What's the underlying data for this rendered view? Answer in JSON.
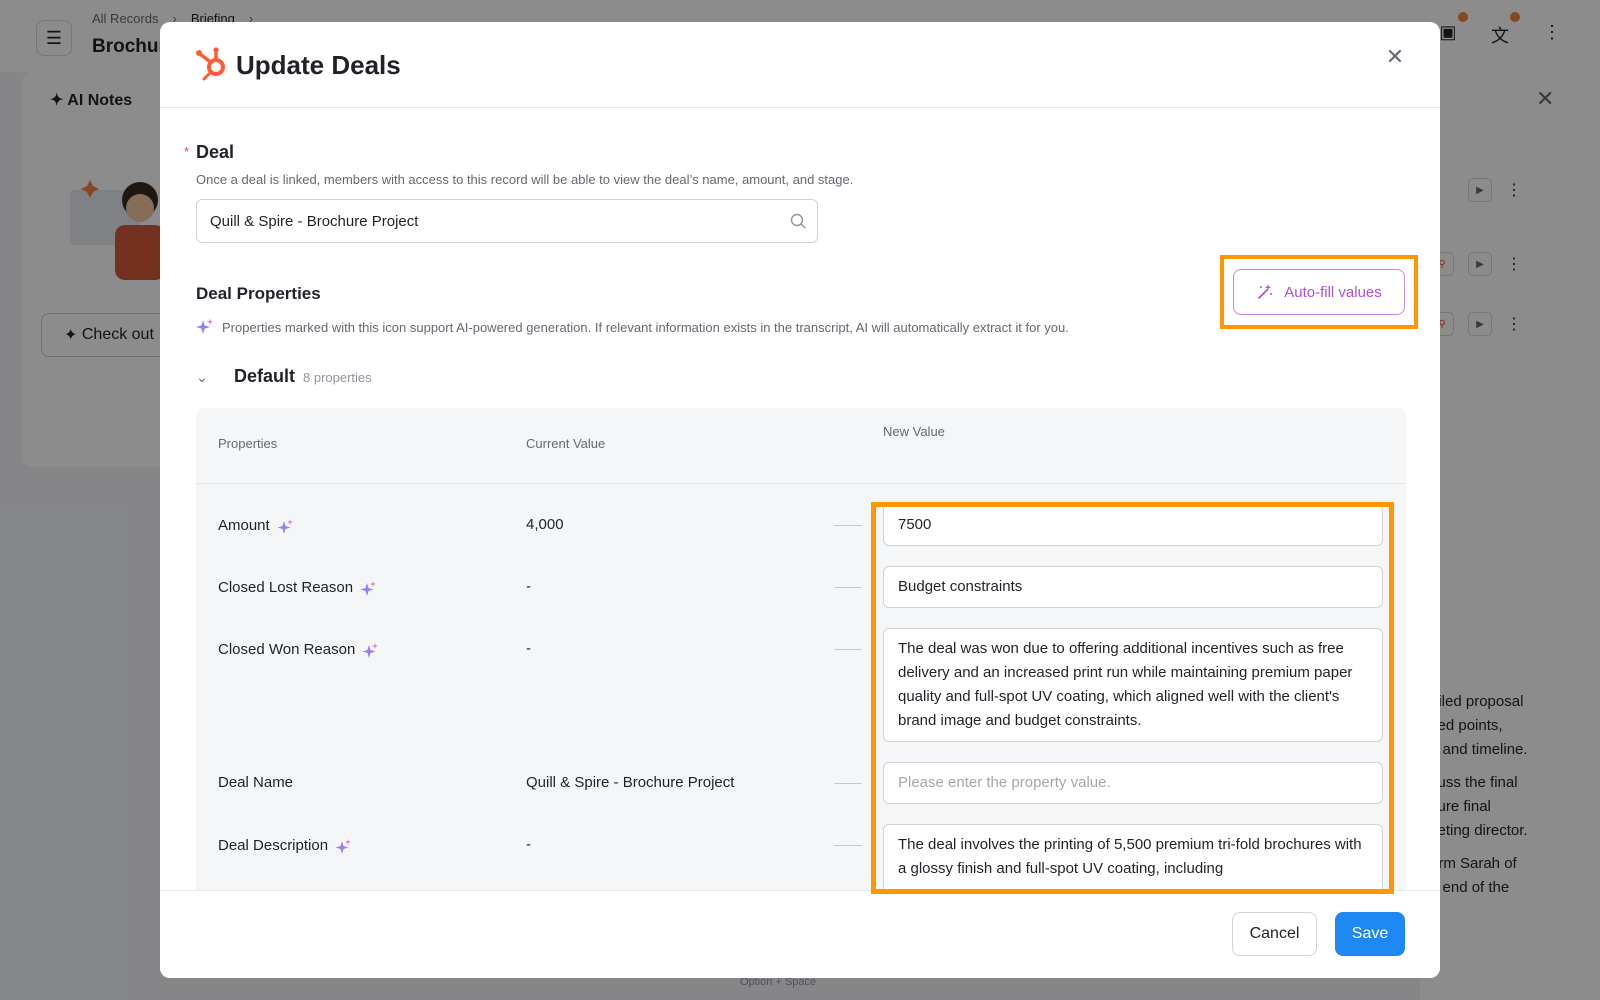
{
  "background": {
    "breadcrumb": [
      "All Records",
      "Briefing"
    ],
    "title": "Brochure",
    "ai_notes_title": "AI Notes",
    "check_out_button": "Check out",
    "right_text": [
      "ailed proposal",
      "sed points,",
      "g and timeline.",
      "cuss the final",
      "cure final",
      "keting director.",
      "orm Sarah of",
      "e end of the"
    ],
    "bottom_hint": "Option + Space",
    "accent_color": "#f0863c"
  },
  "modal": {
    "title": "Update Deals",
    "deal_field": {
      "required_mark": "*",
      "label": "Deal",
      "help": "Once a deal is linked, members with access to this record will be able to view the deal’s name, amount, and stage.",
      "value": "Quill & Spire - Brochure Project"
    },
    "properties_section": {
      "title": "Deal Properties",
      "ai_note": "Properties marked with this icon support AI-powered generation. If relevant information exists in the transcript, AI will automatically extract it for you.",
      "autofill_label": "Auto-fill values"
    },
    "group": {
      "name": "Default",
      "count": "8 properties"
    },
    "table": {
      "headers": {
        "properties": "Properties",
        "current": "Current Value",
        "new": "New Value"
      },
      "rows": [
        {
          "name": "Amount",
          "ai": true,
          "current": "4,000",
          "new": "7500",
          "placeholder": ""
        },
        {
          "name": "Closed Lost Reason",
          "ai": true,
          "current": "-",
          "new": "Budget constraints",
          "placeholder": ""
        },
        {
          "name": "Closed Won Reason",
          "ai": true,
          "current": "-",
          "new": "The deal was won due to offering additional incentives such as free delivery and an increased print run while maintaining premium paper quality and full-spot UV coating, which aligned well with the client's brand image and budget constraints.",
          "placeholder": ""
        },
        {
          "name": "Deal Name",
          "ai": false,
          "current": "Quill & Spire - Brochure Project",
          "new": "",
          "placeholder": "Please enter the property value."
        },
        {
          "name": "Deal Description",
          "ai": true,
          "current": "-",
          "new": "The deal involves the printing of 5,500 premium tri-fold brochures with a glossy finish and full-spot UV coating, including",
          "placeholder": ""
        }
      ]
    },
    "footer": {
      "cancel": "Cancel",
      "save": "Save"
    },
    "colors": {
      "primary": "#1e88f5",
      "highlight": "#ff9800",
      "ai_purple": "#b150d8",
      "hubspot_orange": "#ff5c35"
    }
  }
}
